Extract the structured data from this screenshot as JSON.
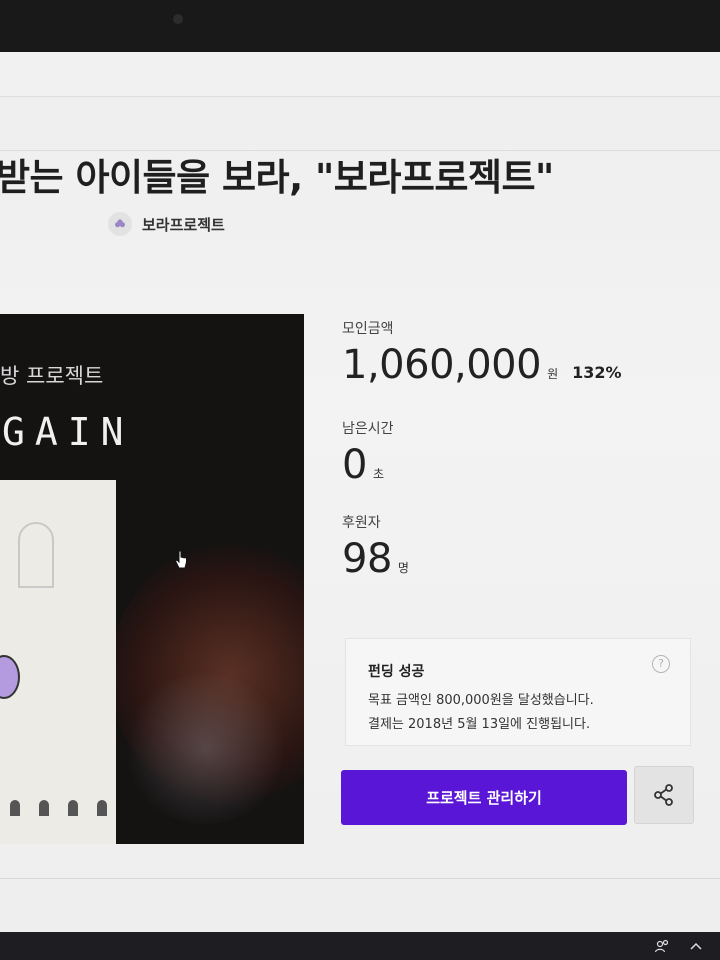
{
  "project": {
    "title": "받는 아이들을 보라, \"보라프로젝트\"",
    "creator": "보라프로젝트"
  },
  "media": {
    "subtitle": "방 프로젝트",
    "headline": "GAIN"
  },
  "stats": {
    "raised_label": "모인금액",
    "raised_value": "1,060,000",
    "raised_unit": "원",
    "raised_percent": "132%",
    "time_label": "남은시간",
    "time_value": "0",
    "time_unit": "초",
    "backers_label": "후원자",
    "backers_value": "98",
    "backers_unit": "명"
  },
  "notice": {
    "title": "펀딩 성공",
    "help": "?",
    "line1": "목표 금액인 800,000원을 달성했습니다.",
    "line2": "결제는 2018년 5월 13일에 진행됩니다."
  },
  "actions": {
    "manage_label": "프로젝트 관리하기"
  },
  "colors": {
    "accent": "#5a16d6",
    "creator_icon": "#9a86c6"
  },
  "icons": {
    "creator": "flower-icon",
    "share": "share-icon",
    "cursor": "hand-cursor-icon",
    "help": "question-icon"
  }
}
